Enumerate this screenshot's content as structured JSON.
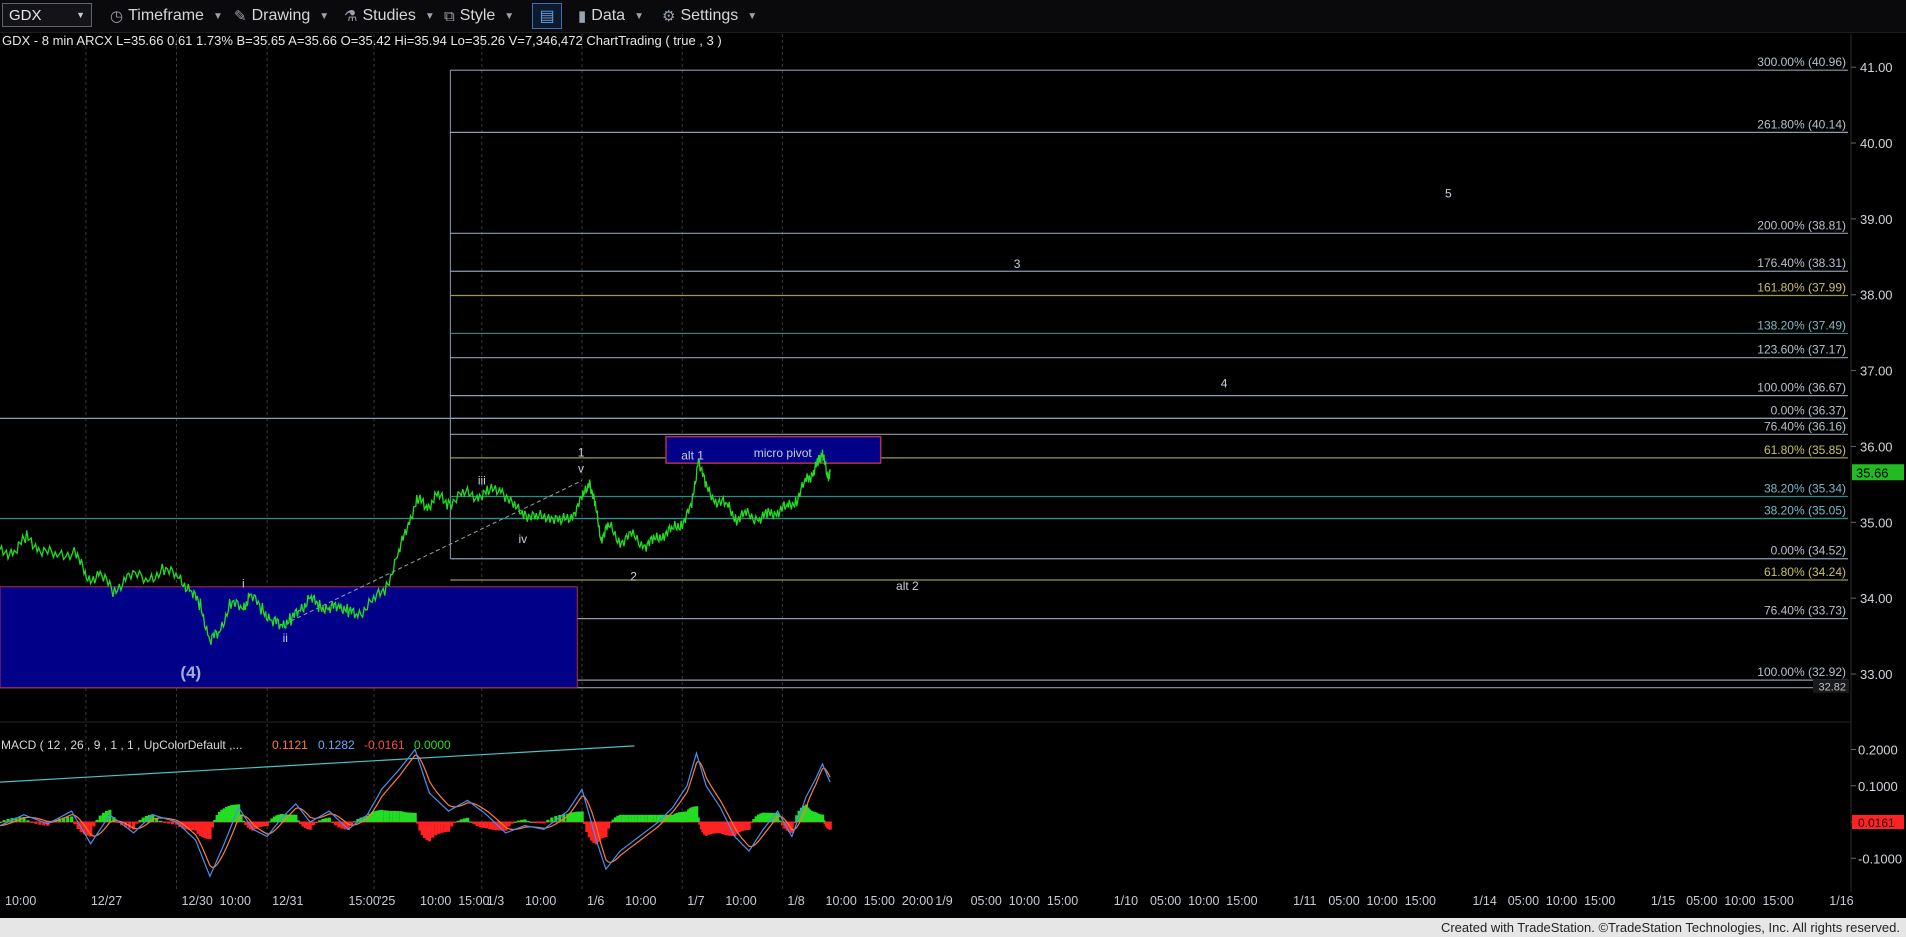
{
  "toolbar": {
    "symbol": "GDX",
    "items": [
      {
        "id": "timeframe",
        "label": "Timeframe",
        "icon": "clock-icon"
      },
      {
        "id": "drawing",
        "label": "Drawing",
        "icon": "pencil-icon"
      },
      {
        "id": "studies",
        "label": "Studies",
        "icon": "flask-icon"
      },
      {
        "id": "style",
        "label": "Style",
        "icon": "chart-style-icon"
      },
      {
        "id": "data",
        "label": "Data",
        "icon": "bar-chart-icon"
      },
      {
        "id": "settings",
        "label": "Settings",
        "icon": "gear-icon"
      }
    ]
  },
  "header_line": "GDX - 8 min  ARCX  L=35.66  0.61  1.73%  B=35.65  A=35.66  O=35.42  Hi=35.94  Lo=35.26  V=7,346,472  ChartTrading ( true , 3 )",
  "macd_header": {
    "label": "MACD ( 12 , 26 , 9 , 1 , 1 , UpColorDefault ,...",
    "v1": "0.1121",
    "v2": "0.1282",
    "v3": "-0.0161",
    "v4": "0.0000"
  },
  "colors": {
    "price_line": "#22dd22",
    "macd_line": "#4a8ff0",
    "signal_line": "#ff7a3d",
    "hist_pos": "#22dd22",
    "hist_neg": "#ff2222",
    "support_box": "#000088",
    "pivot_box": "#000088",
    "pivot_border": "#b03050",
    "last_price_bg": "#22bb22",
    "macd_last_bg": "#ff2222"
  },
  "chart_data": {
    "type": "line",
    "symbol": "GDX",
    "interval": "8 min",
    "ylim": [
      32.75,
      41.2
    ],
    "price_axis_ticks": [
      "41.00",
      "40.00",
      "39.00",
      "38.00",
      "37.00",
      "36.00",
      "35.00",
      "34.00",
      "33.00"
    ],
    "last_price": "35.66",
    "x_axis_ticks": [
      {
        "label": "10:00",
        "t": 0.0
      },
      {
        "label": "12/27",
        "t": 0.9
      },
      {
        "label": "12/30",
        "t": 1.85
      },
      {
        "label": "10:00",
        "t": 2.25
      },
      {
        "label": "12/31",
        "t": 2.8
      },
      {
        "label": "15:00",
        "t": 3.6
      },
      {
        "label": "'25",
        "t": 3.92
      },
      {
        "label": "10:00",
        "t": 4.35
      },
      {
        "label": "15:00",
        "t": 4.75
      },
      {
        "label": "1/3",
        "t": 5.05
      },
      {
        "label": "10:00",
        "t": 5.45
      },
      {
        "label": "1/6",
        "t": 6.1
      },
      {
        "label": "10:00",
        "t": 6.5
      },
      {
        "label": "1/7",
        "t": 7.15
      },
      {
        "label": "10:00",
        "t": 7.55
      },
      {
        "label": "1/8",
        "t": 8.2
      },
      {
        "label": "10:00",
        "t": 8.6
      },
      {
        "label": "15:00",
        "t": 9.0
      },
      {
        "label": "20:00",
        "t": 9.4
      },
      {
        "label": "1/9",
        "t": 9.75
      },
      {
        "label": "05:00",
        "t": 10.12
      },
      {
        "label": "10:00",
        "t": 10.52
      },
      {
        "label": "15:00",
        "t": 10.92
      },
      {
        "label": "1/10",
        "t": 11.62
      },
      {
        "label": "05:00",
        "t": 12.0
      },
      {
        "label": "10:00",
        "t": 12.4
      },
      {
        "label": "15:00",
        "t": 12.8
      },
      {
        "label": "1/11",
        "t": 13.5
      },
      {
        "label": "05:00",
        "t": 13.87
      },
      {
        "label": "10:00",
        "t": 14.27
      },
      {
        "label": "15:00",
        "t": 14.67
      },
      {
        "label": "1/14",
        "t": 15.38
      },
      {
        "label": "05:00",
        "t": 15.75
      },
      {
        "label": "10:00",
        "t": 16.15
      },
      {
        "label": "15:00",
        "t": 16.55
      },
      {
        "label": "1/15",
        "t": 17.25
      },
      {
        "label": "05:00",
        "t": 17.62
      },
      {
        "label": "10:00",
        "t": 18.02
      },
      {
        "label": "15:00",
        "t": 18.42
      },
      {
        "label": "1/16",
        "t": 19.12
      }
    ],
    "x_range": [
      0,
      19.4
    ],
    "price_series": [
      {
        "t": 0.0,
        "p": 34.6
      },
      {
        "t": 0.15,
        "p": 34.62
      },
      {
        "t": 0.28,
        "p": 34.8
      },
      {
        "t": 0.42,
        "p": 34.65
      },
      {
        "t": 0.6,
        "p": 34.55
      },
      {
        "t": 0.8,
        "p": 34.62
      },
      {
        "t": 0.92,
        "p": 34.2
      },
      {
        "t": 1.05,
        "p": 34.35
      },
      {
        "t": 1.2,
        "p": 34.05
      },
      {
        "t": 1.35,
        "p": 34.35
      },
      {
        "t": 1.55,
        "p": 34.22
      },
      {
        "t": 1.72,
        "p": 34.4
      },
      {
        "t": 1.88,
        "p": 34.25
      },
      {
        "t": 2.0,
        "p": 34.1
      },
      {
        "t": 2.1,
        "p": 33.9
      },
      {
        "t": 2.2,
        "p": 33.45
      },
      {
        "t": 2.3,
        "p": 33.55
      },
      {
        "t": 2.42,
        "p": 33.95
      },
      {
        "t": 2.55,
        "p": 33.85
      },
      {
        "t": 2.62,
        "p": 34.05
      },
      {
        "t": 2.75,
        "p": 33.85
      },
      {
        "t": 2.85,
        "p": 33.7
      },
      {
        "t": 2.95,
        "p": 33.65
      },
      {
        "t": 3.05,
        "p": 33.72
      },
      {
        "t": 3.15,
        "p": 33.85
      },
      {
        "t": 3.25,
        "p": 34.0
      },
      {
        "t": 3.35,
        "p": 33.9
      },
      {
        "t": 3.45,
        "p": 33.85
      },
      {
        "t": 3.55,
        "p": 33.92
      },
      {
        "t": 3.65,
        "p": 33.82
      },
      {
        "t": 3.75,
        "p": 33.78
      },
      {
        "t": 3.9,
        "p": 33.95
      },
      {
        "t": 4.05,
        "p": 34.15
      },
      {
        "t": 4.18,
        "p": 34.6
      },
      {
        "t": 4.28,
        "p": 35.0
      },
      {
        "t": 4.38,
        "p": 35.3
      },
      {
        "t": 4.48,
        "p": 35.2
      },
      {
        "t": 4.58,
        "p": 35.35
      },
      {
        "t": 4.7,
        "p": 35.25
      },
      {
        "t": 4.85,
        "p": 35.38
      },
      {
        "t": 5.0,
        "p": 35.35
      },
      {
        "t": 5.12,
        "p": 35.4
      },
      {
        "t": 5.25,
        "p": 35.45
      },
      {
        "t": 5.38,
        "p": 35.2
      },
      {
        "t": 5.5,
        "p": 35.12
      },
      {
        "t": 5.62,
        "p": 35.05
      },
      {
        "t": 5.75,
        "p": 35.1
      },
      {
        "t": 5.88,
        "p": 35.0
      },
      {
        "t": 6.0,
        "p": 35.1
      },
      {
        "t": 6.1,
        "p": 35.3
      },
      {
        "t": 6.18,
        "p": 35.55
      },
      {
        "t": 6.24,
        "p": 35.2
      },
      {
        "t": 6.3,
        "p": 34.8
      },
      {
        "t": 6.38,
        "p": 34.95
      },
      {
        "t": 6.5,
        "p": 34.75
      },
      {
        "t": 6.62,
        "p": 34.82
      },
      {
        "t": 6.75,
        "p": 34.7
      },
      {
        "t": 6.85,
        "p": 34.75
      },
      {
        "t": 6.95,
        "p": 34.85
      },
      {
        "t": 7.05,
        "p": 34.9
      },
      {
        "t": 7.15,
        "p": 35.0
      },
      {
        "t": 7.25,
        "p": 35.2
      },
      {
        "t": 7.32,
        "p": 35.85
      },
      {
        "t": 7.4,
        "p": 35.45
      },
      {
        "t": 7.5,
        "p": 35.3
      },
      {
        "t": 7.62,
        "p": 35.22
      },
      {
        "t": 7.72,
        "p": 35.05
      },
      {
        "t": 7.82,
        "p": 35.1
      },
      {
        "t": 7.95,
        "p": 35.05
      },
      {
        "t": 8.05,
        "p": 35.1
      },
      {
        "t": 8.15,
        "p": 35.15
      },
      {
        "t": 8.25,
        "p": 35.2
      },
      {
        "t": 8.35,
        "p": 35.3
      },
      {
        "t": 8.45,
        "p": 35.55
      },
      {
        "t": 8.52,
        "p": 35.65
      },
      {
        "t": 8.58,
        "p": 35.8
      },
      {
        "t": 8.62,
        "p": 35.94
      },
      {
        "t": 8.67,
        "p": 35.6
      },
      {
        "t": 8.7,
        "p": 35.66
      }
    ],
    "fib_levels": [
      {
        "label": "300.00% (40.96)",
        "price": 40.96,
        "color": "#8e9bb0"
      },
      {
        "label": "261.80% (40.14)",
        "price": 40.14,
        "color": "#8e9bb0"
      },
      {
        "label": "200.00% (38.81)",
        "price": 38.81,
        "color": "#8e9bb0"
      },
      {
        "label": "176.40% (38.31)",
        "price": 38.31,
        "color": "#8e9bb0"
      },
      {
        "label": "161.80% (37.99)",
        "price": 37.99,
        "color": "#9a9a4a"
      },
      {
        "label": "138.20% (37.49)",
        "price": 37.49,
        "color": "#2e8a8a"
      },
      {
        "label": "123.60% (37.17)",
        "price": 37.17,
        "color": "#8e9bb0"
      },
      {
        "label": "100.00% (36.67)",
        "price": 36.67,
        "color": "#8e9bb0"
      },
      {
        "label": "0.00% (36.37)",
        "price": 36.37,
        "color": "#8e9bb0"
      },
      {
        "label": "76.40% (36.16)",
        "price": 36.16,
        "color": "#8e9bb0"
      },
      {
        "label": "61.80% (35.85)",
        "price": 35.85,
        "color": "#9a9a4a"
      },
      {
        "label": "38.20% (35.34)",
        "price": 35.34,
        "color": "#2e8a8a"
      },
      {
        "label": "38.20% (35.05)",
        "price": 35.05,
        "color": "#2e8a8a"
      },
      {
        "label": "0.00% (34.52)",
        "price": 34.52,
        "color": "#8e9bb0"
      },
      {
        "label": "61.80% (34.24)",
        "price": 34.24,
        "color": "#9a9a4a"
      },
      {
        "label": "76.40% (33.73)",
        "price": 33.73,
        "color": "#8e9bb0"
      },
      {
        "label": "100.00% (32.92)",
        "price": 32.92,
        "color": "#8e9bb0"
      }
    ],
    "extra_price_label": "32.82",
    "wave_labels": [
      {
        "text": "(4)",
        "t": 2.0,
        "p": 32.95,
        "big": true
      },
      {
        "text": "i",
        "t": 2.55,
        "p": 34.14
      },
      {
        "text": "ii",
        "t": 2.99,
        "p": 33.42
      },
      {
        "text": "iii",
        "t": 5.05,
        "p": 35.5
      },
      {
        "text": "iv",
        "t": 5.48,
        "p": 34.73
      },
      {
        "text": "1",
        "t": 6.09,
        "p": 35.87
      },
      {
        "text": "v",
        "t": 6.09,
        "p": 35.66
      },
      {
        "text": "2",
        "t": 6.64,
        "p": 34.23
      },
      {
        "text": "alt 1",
        "t": 7.14,
        "p": 35.83
      },
      {
        "text": "micro pivot",
        "t": 7.9,
        "p": 35.86
      },
      {
        "text": "alt 2",
        "t": 9.51,
        "p": 34.11
      },
      {
        "text": "3",
        "t": 10.66,
        "p": 38.35
      },
      {
        "text": "4",
        "t": 12.83,
        "p": 36.78
      },
      {
        "text": "5",
        "t": 15.18,
        "p": 39.28
      }
    ],
    "support_box": {
      "t0": 0.0,
      "t1": 6.05,
      "p0": 32.82,
      "p1": 34.15
    },
    "pivot_box": {
      "t0": 6.98,
      "t1": 9.23,
      "p0": 35.78,
      "p1": 36.13
    },
    "fib_box": {
      "t0": 4.72,
      "p_top": 40.96,
      "p_bottom": 34.52
    },
    "trend_line": {
      "t0": 3.05,
      "p0": 33.7,
      "t1": 6.1,
      "p1": 35.55
    },
    "vertical_dashed_lines_t": [
      0.9,
      1.85,
      2.8,
      3.92,
      5.05,
      6.1,
      7.15,
      8.2
    ],
    "macd": {
      "ylim": [
        -0.16,
        0.24
      ],
      "ticks": [
        "0.2000",
        "0.1000",
        "0.0000",
        "-0.1000"
      ],
      "last_value": "0.0161",
      "macd_points": [
        {
          "t": 0.0,
          "v": -0.01
        },
        {
          "t": 0.25,
          "v": 0.02
        },
        {
          "t": 0.5,
          "v": -0.005
        },
        {
          "t": 0.75,
          "v": 0.03
        },
        {
          "t": 0.95,
          "v": -0.06
        },
        {
          "t": 1.15,
          "v": 0.02
        },
        {
          "t": 1.4,
          "v": -0.03
        },
        {
          "t": 1.6,
          "v": 0.02
        },
        {
          "t": 1.85,
          "v": 0.0
        },
        {
          "t": 2.05,
          "v": -0.05
        },
        {
          "t": 2.2,
          "v": -0.15
        },
        {
          "t": 2.35,
          "v": -0.06
        },
        {
          "t": 2.5,
          "v": 0.04
        },
        {
          "t": 2.65,
          "v": -0.02
        },
        {
          "t": 2.8,
          "v": -0.04
        },
        {
          "t": 2.95,
          "v": 0.01
        },
        {
          "t": 3.1,
          "v": 0.05
        },
        {
          "t": 3.25,
          "v": 0.0
        },
        {
          "t": 3.45,
          "v": 0.03
        },
        {
          "t": 3.65,
          "v": -0.02
        },
        {
          "t": 3.85,
          "v": 0.02
        },
        {
          "t": 4.0,
          "v": 0.09
        },
        {
          "t": 4.2,
          "v": 0.15
        },
        {
          "t": 4.35,
          "v": 0.2
        },
        {
          "t": 4.5,
          "v": 0.08
        },
        {
          "t": 4.7,
          "v": 0.03
        },
        {
          "t": 4.9,
          "v": 0.06
        },
        {
          "t": 5.1,
          "v": 0.02
        },
        {
          "t": 5.3,
          "v": -0.03
        },
        {
          "t": 5.5,
          "v": -0.01
        },
        {
          "t": 5.7,
          "v": -0.02
        },
        {
          "t": 5.95,
          "v": 0.03
        },
        {
          "t": 6.1,
          "v": 0.09
        },
        {
          "t": 6.25,
          "v": -0.05
        },
        {
          "t": 6.35,
          "v": -0.13
        },
        {
          "t": 6.5,
          "v": -0.08
        },
        {
          "t": 6.7,
          "v": -0.04
        },
        {
          "t": 6.9,
          "v": 0.0
        },
        {
          "t": 7.05,
          "v": 0.04
        },
        {
          "t": 7.2,
          "v": 0.1
        },
        {
          "t": 7.3,
          "v": 0.19
        },
        {
          "t": 7.4,
          "v": 0.1
        },
        {
          "t": 7.55,
          "v": 0.04
        },
        {
          "t": 7.7,
          "v": -0.04
        },
        {
          "t": 7.85,
          "v": -0.08
        },
        {
          "t": 8.0,
          "v": -0.02
        },
        {
          "t": 8.15,
          "v": 0.03
        },
        {
          "t": 8.3,
          "v": -0.04
        },
        {
          "t": 8.45,
          "v": 0.07
        },
        {
          "t": 8.55,
          "v": 0.12
        },
        {
          "t": 8.62,
          "v": 0.16
        },
        {
          "t": 8.7,
          "v": 0.11
        }
      ],
      "signal_offset": 0.07,
      "signal_trend": {
        "t0": 0.0,
        "v0": 0.11,
        "t1": 6.65,
        "v1": 0.21
      }
    }
  },
  "footer_text": "Created with TradeStation. ©TradeStation Technologies, Inc. All rights reserved."
}
